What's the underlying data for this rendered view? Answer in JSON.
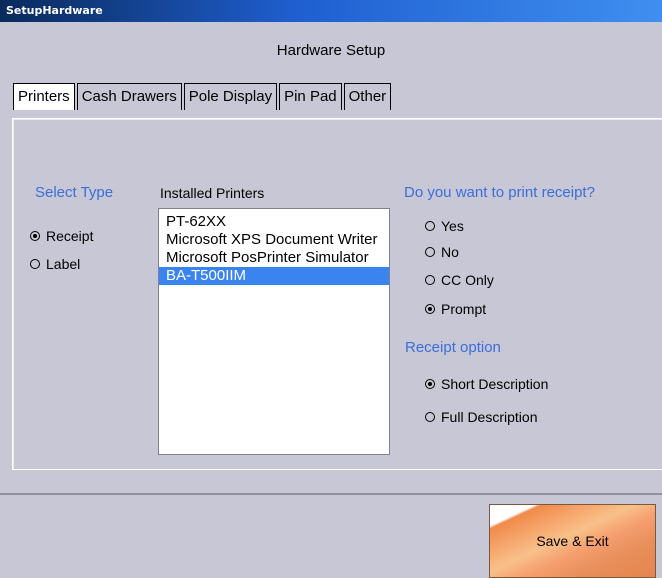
{
  "titlebar": {
    "title": "SetupHardware"
  },
  "header": {
    "title": "Hardware Setup"
  },
  "tabs": [
    {
      "label": "Printers",
      "active": true
    },
    {
      "label": "Cash Drawers",
      "active": false
    },
    {
      "label": "Pole Display",
      "active": false
    },
    {
      "label": "Pin Pad",
      "active": false
    },
    {
      "label": "Other",
      "active": false
    }
  ],
  "select_type": {
    "label": "Select Type",
    "options": [
      {
        "label": "Receipt",
        "selected": true
      },
      {
        "label": "Label",
        "selected": false
      }
    ]
  },
  "installed_printers": {
    "label": "Installed Printers",
    "items": [
      {
        "label": "PT-62XX",
        "selected": false
      },
      {
        "label": "Microsoft XPS Document Writer",
        "selected": false
      },
      {
        "label": "Microsoft PosPrinter Simulator",
        "selected": false
      },
      {
        "label": "BA-T500IIM",
        "selected": true
      }
    ]
  },
  "print_receipt": {
    "label": "Do you want to print receipt?",
    "options": [
      {
        "label": "Yes",
        "selected": false
      },
      {
        "label": "No",
        "selected": false
      },
      {
        "label": "CC Only",
        "selected": false
      },
      {
        "label": "Prompt",
        "selected": true
      }
    ]
  },
  "receipt_option": {
    "label": "Receipt option",
    "options": [
      {
        "label": "Short Description",
        "selected": true
      },
      {
        "label": "Full Description",
        "selected": false
      }
    ]
  },
  "save_button": {
    "label": "Save & Exit"
  },
  "colors": {
    "accent_blue": "#3b6ed8",
    "selection": "#3a84f0",
    "window_bg": "#c7c7d6"
  }
}
